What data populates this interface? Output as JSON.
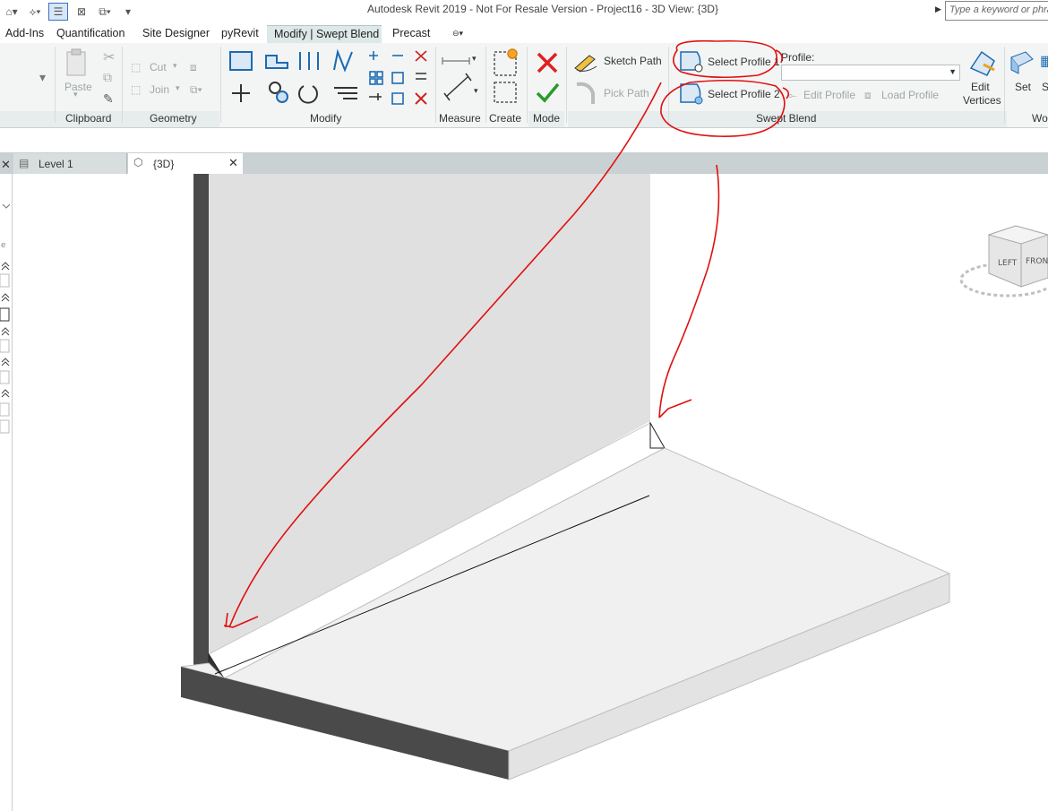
{
  "window": {
    "title": "Autodesk Revit 2019 - Not For Resale Version - Project16 - 3D View: {3D}",
    "search_placeholder": "Type a keyword or phrase"
  },
  "tabs": [
    {
      "label": "Add-Ins"
    },
    {
      "label": "Quantification"
    },
    {
      "label": "Site Designer"
    },
    {
      "label": "pyRevit"
    },
    {
      "label": "Modify | Swept Blend"
    },
    {
      "label": "Precast"
    }
  ],
  "ribbon": {
    "clipboard": {
      "paste": "Paste",
      "panel": "Clipboard"
    },
    "geometry": {
      "cut": "Cut",
      "join": "Join",
      "panel": "Geometry"
    },
    "modify": {
      "panel": "Modify"
    },
    "measure": {
      "panel": "Measure"
    },
    "create": {
      "panel": "Create"
    },
    "mode": {
      "panel": "Mode"
    },
    "swept_blend": {
      "sketch_path": "Sketch Path",
      "pick_path": "Pick Path",
      "select_profile_1": "Select Profile 1",
      "select_profile_2": "Select Profile 2",
      "profile_label": "Profile:",
      "edit_profile": "Edit Profile",
      "load_profile": "Load Profile",
      "edit_vertices_1": "Edit",
      "edit_vertices_2": "Vertices",
      "panel": "Swept Blend"
    },
    "workplane": {
      "set": "Set",
      "next_partial": "S",
      "panel_partial": "Wo"
    }
  },
  "view_tabs": [
    {
      "label": "Level 1"
    },
    {
      "label": "{3D}"
    }
  ],
  "viewcube": {
    "left": "LEFT",
    "front": "FRONT"
  },
  "colors": {
    "annotation_red": "#e01010",
    "active_tab": "#dde8e8",
    "wall_dark": "#4a4a4a"
  }
}
